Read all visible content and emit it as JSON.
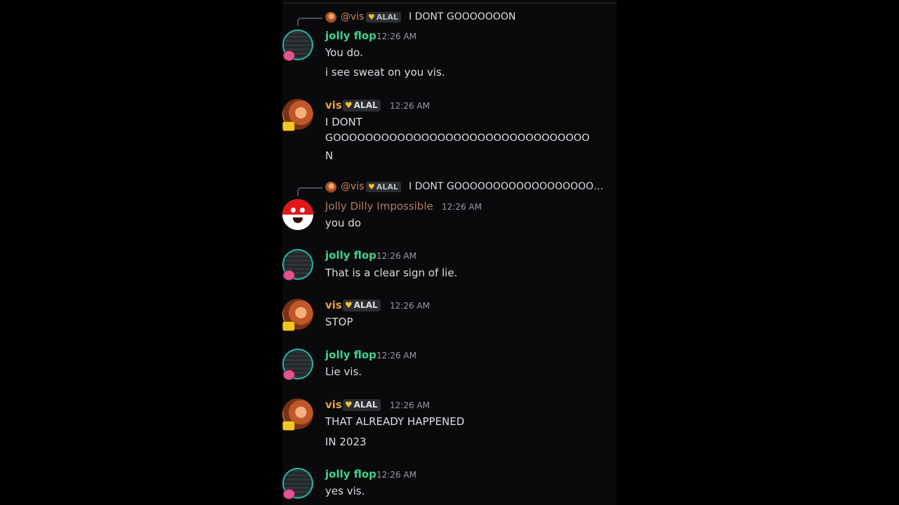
{
  "colors": {
    "jolly_flop_name": "#3dd38b",
    "vis_name": "#e7a33a",
    "jolly_dilly_name": "#b07a66",
    "message_text": "#dbdee1",
    "timestamp": "#949ba4"
  },
  "messages": [
    {
      "reply": {
        "author": "@vis",
        "badge": "ALAL",
        "text": "I DONT GOOOOOOON"
      },
      "author": "jolly flop",
      "time": "12:26 AM",
      "lines": [
        "You do.",
        "i see sweat on you vis."
      ]
    },
    {
      "author": "vis",
      "badge": "ALAL",
      "time": "12:26 AM",
      "lines": [
        "I DONT",
        "GOOOOOOOOOOOOOOOOOOOOOOOOOOOOOOOO",
        "N"
      ]
    },
    {
      "reply": {
        "author": "@vis",
        "badge": "ALAL",
        "text": "I DONT GOOOOOOOOOOOOOOOOOOOO..."
      },
      "author": "Jolly Dilly Impossible",
      "time": "12:26 AM",
      "lines": [
        "you do"
      ]
    },
    {
      "author": "jolly flop",
      "time": "12:26 AM",
      "lines": [
        "That is a clear sign of lie."
      ]
    },
    {
      "author": "vis",
      "badge": "ALAL",
      "time": "12:26 AM",
      "lines": [
        "STOP"
      ]
    },
    {
      "author": "jolly flop",
      "time": "12:26 AM",
      "lines": [
        "Lie vis."
      ]
    },
    {
      "author": "vis",
      "badge": "ALAL",
      "time": "12:26 AM",
      "lines": [
        "THAT ALREADY HAPPENED",
        "IN 2023"
      ]
    },
    {
      "author": "jolly flop",
      "time": "12:26 AM",
      "lines": [
        "yes vis."
      ]
    }
  ]
}
